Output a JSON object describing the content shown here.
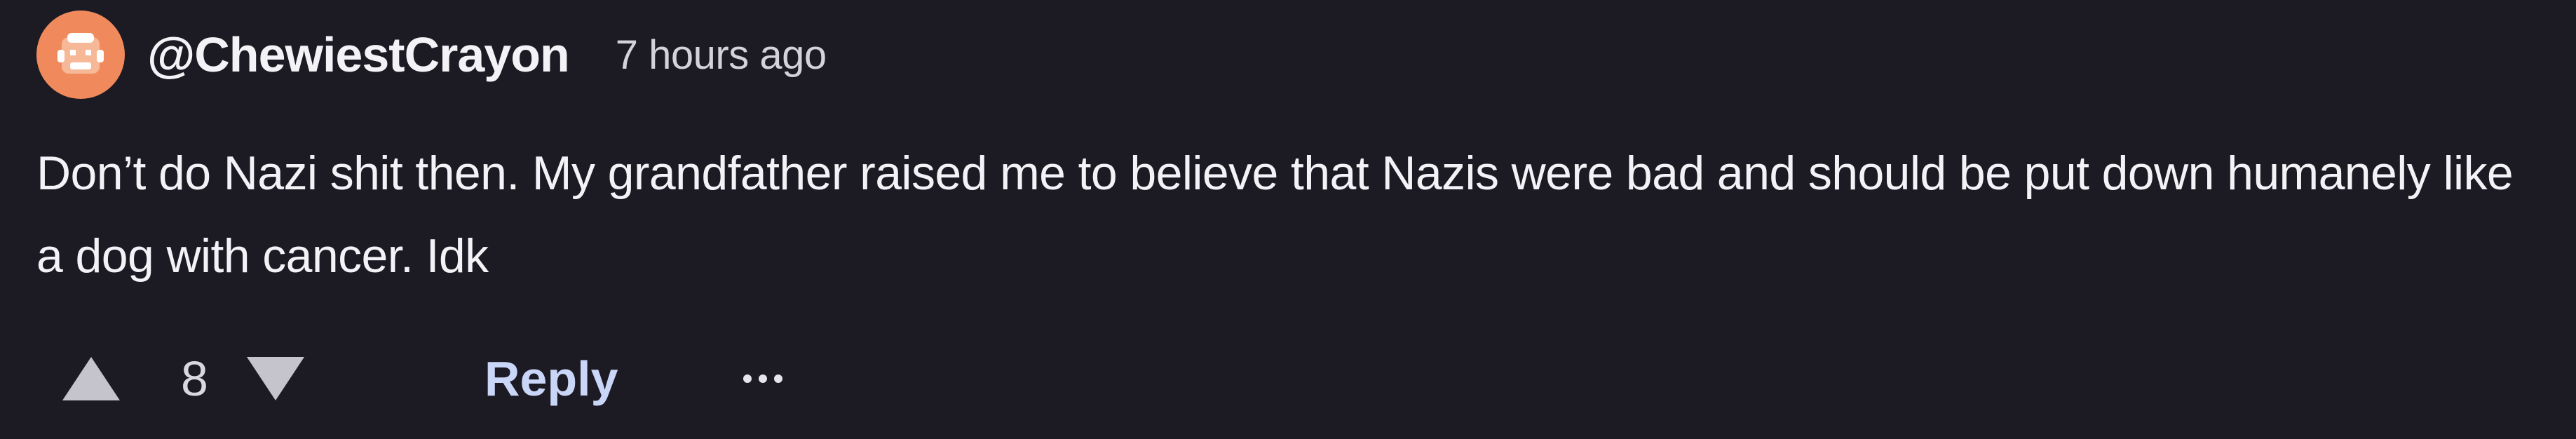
{
  "comment": {
    "avatar_icon": "face-avatar-icon",
    "avatar_color": "#f08a5d",
    "username": "@ChewiestCrayon",
    "timestamp": "7 hours ago",
    "text": "Don’t do Nazi shit then. My grandfather raised me to believe that Nazis were bad and should be put down humanely like a dog with cancer. Idk",
    "vote_count": "8",
    "reply_label": "Reply",
    "more_icon": "more-options-icon"
  }
}
